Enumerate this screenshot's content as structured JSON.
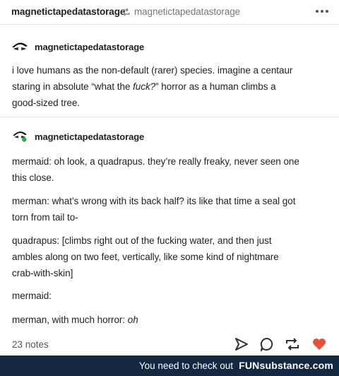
{
  "header": {
    "username": "magnetictapedatastorage",
    "reblog_icon": "reblog-arrows-icon",
    "source_username": "magnetictapedatastorage",
    "more_icon": "ellipsis-icon"
  },
  "post1": {
    "username": "magnetictapedatastorage",
    "avatar_icon": "eye-avatar-icon",
    "lines": [
      "i love humans as the non-default (rarer) species. imagine a centaur",
      "staring in absolute “what the ",
      "fuck?",
      "” horror as a human climbs a",
      "good-sized tree."
    ]
  },
  "post2": {
    "username": "magnetictapedatastorage",
    "avatar_icon": "eye-avatar-icon",
    "paragraphs": [
      {
        "line1": "mermaid: oh look, a quadrapus. they’re really freaky, never seen one",
        "line2": "this close."
      },
      {
        "line1": "merman: what’s wrong with its back half? its like that time a seal got",
        "line2": "torn from tail to-"
      },
      {
        "line1": "quadrapus: [climbs right out of the fucking water, and then just",
        "line2": "ambles along on two feet, vertically, like some kind of nightmare",
        "line3": "crab-with-skin]"
      },
      {
        "line1": "mermaid:"
      },
      {
        "line1_pre": "merman, with much horror: ",
        "line1_em": "oh"
      }
    ]
  },
  "footer_actions": {
    "notes": "23 notes",
    "icons": [
      "share-icon",
      "reply-icon",
      "reblog-icon",
      "like-heart-icon"
    ],
    "like_color": "#e8503a"
  },
  "watermark": {
    "text": "You need to check out",
    "brand": "FUNsubstance.com",
    "bg_color": "#152842"
  }
}
